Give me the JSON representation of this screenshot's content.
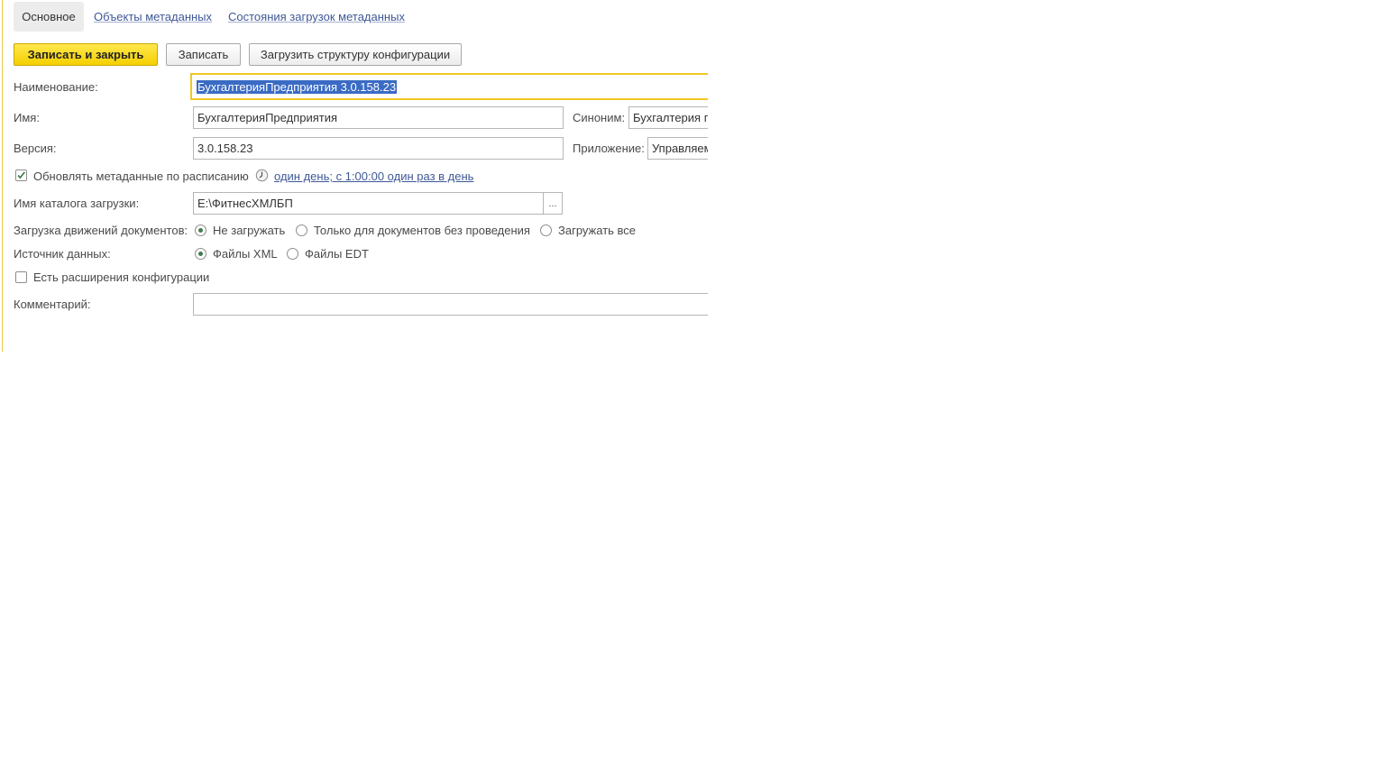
{
  "tabs": [
    {
      "label": "Основное",
      "active": true
    },
    {
      "label": "Объекты метаданных",
      "active": false
    },
    {
      "label": "Состояния загрузок метаданных",
      "active": false
    }
  ],
  "toolbar": {
    "save_close_label": "Записать и закрыть",
    "save_label": "Записать",
    "load_structure_label": "Загрузить структуру конфигурации"
  },
  "fields": {
    "name_label": "Наименование:",
    "name_value": "БухгалтерияПредприятия 3.0.158.23",
    "id_label": "Имя:",
    "id_value": "БухгалтерияПредприятия",
    "synonym_label": "Синоним:",
    "synonym_value": "Бухгалтерия п",
    "version_label": "Версия:",
    "version_value": "3.0.158.23",
    "app_label": "Приложение:",
    "app_value": "Управляем",
    "schedule_checkbox_label": "Обновлять метаданные по расписанию",
    "schedule_checked": true,
    "schedule_link": "один день; с 1:00:00 один раз в день",
    "catalog_label": "Имя каталога загрузки:",
    "catalog_value": "E:\\ФитнесХМЛБП",
    "catalog_button": "...",
    "movements_label": "Загрузка движений документов:",
    "movements_options": [
      "Не загружать",
      "Только для документов без проведения",
      "Загружать все"
    ],
    "movements_selected": 0,
    "source_label": "Источник данных:",
    "source_options": [
      "Файлы XML",
      "Файлы EDT"
    ],
    "source_selected": 0,
    "extensions_label": "Есть расширения конфигурации",
    "extensions_checked": false,
    "comment_label": "Комментарий:",
    "comment_value": ""
  },
  "colors": {
    "accent_yellow": "#f4cf00",
    "link_blue": "#3f5896",
    "radio_green": "#3f7c4c",
    "selection_blue": "#3a6bc4"
  }
}
